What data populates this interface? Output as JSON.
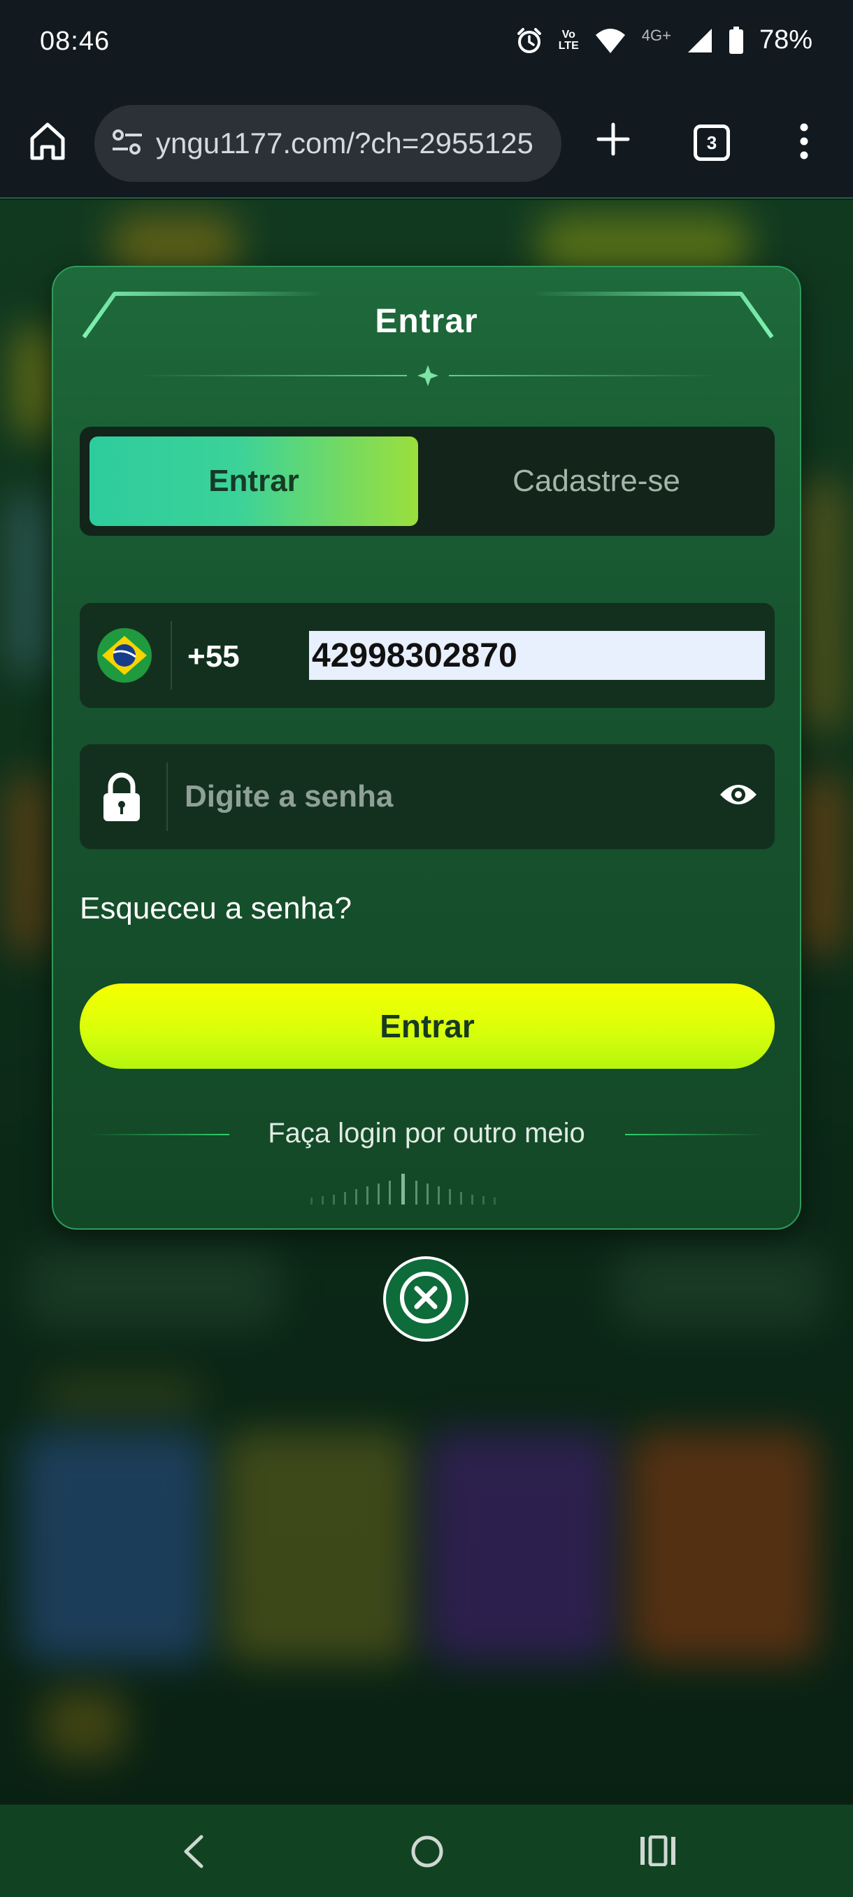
{
  "status_bar": {
    "time": "08:46",
    "lte_label": "Vo\nLTE",
    "network_label": "4G+",
    "battery": "78%"
  },
  "browser": {
    "url": "yngu1177.com/?ch=2955125",
    "tab_count": "3"
  },
  "modal": {
    "title": "Entrar",
    "tabs": {
      "login": "Entrar",
      "register": "Cadastre-se"
    },
    "phone": {
      "country_code": "+55",
      "value": "42998302870"
    },
    "password": {
      "placeholder": "Digite a senha"
    },
    "forgot_link": "Esqueceu a senha?",
    "submit_label": "Entrar",
    "other_login": "Faça login por outro meio"
  },
  "icons": {
    "status": [
      "alarm-icon",
      "volte-icon",
      "wifi-icon",
      "signal-icon",
      "battery-icon"
    ],
    "browser": [
      "home-icon",
      "site-settings-icon",
      "new-tab-icon",
      "tab-switcher-icon",
      "more-menu-icon"
    ],
    "modal": [
      "brazil-flag-icon",
      "lock-icon",
      "eye-icon",
      "close-icon"
    ],
    "nav": [
      "back-icon",
      "home-circle-icon",
      "recent-apps-icon"
    ]
  },
  "colors": {
    "primary_button": "#f6ff00",
    "tab_active_start": "#2ecc9c",
    "tab_active_end": "#9bdf3c",
    "modal_bg": "#1e6a3b",
    "nav_bg": "#114322"
  }
}
